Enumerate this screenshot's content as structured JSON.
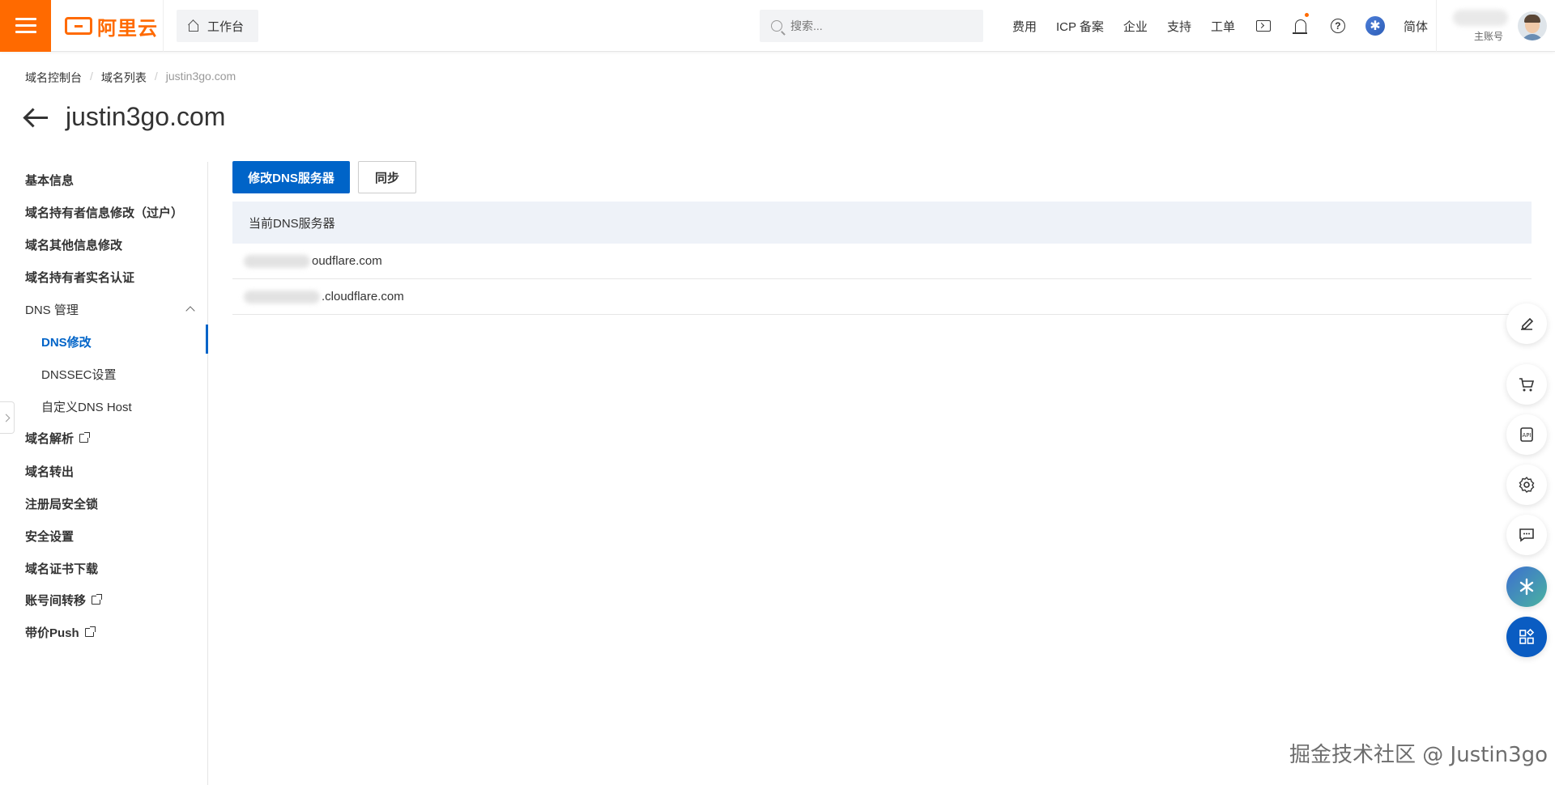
{
  "topbar": {
    "logo_text": "阿里云",
    "workbench_label": "工作台",
    "search_placeholder": "搜索...",
    "nav_items": [
      "费用",
      "ICP 备案",
      "企业",
      "支持",
      "工单"
    ],
    "language": "简体",
    "account_label": "主账号",
    "accent_color": "#ff6a00"
  },
  "breadcrumb": {
    "items": [
      "域名控制台",
      "域名列表",
      "justin3go.com"
    ]
  },
  "page": {
    "title": "justin3go.com"
  },
  "sidebar": {
    "items": [
      {
        "label": "基本信息"
      },
      {
        "label": "域名持有者信息修改（过户）"
      },
      {
        "label": "域名其他信息修改"
      },
      {
        "label": "域名持有者实名认证"
      },
      {
        "label": "DNS 管理"
      },
      {
        "label": "DNS修改"
      },
      {
        "label": "DNSSEC设置"
      },
      {
        "label": "自定义DNS Host"
      },
      {
        "label": "域名解析"
      },
      {
        "label": "域名转出"
      },
      {
        "label": "注册局安全锁"
      },
      {
        "label": "安全设置"
      },
      {
        "label": "域名证书下载"
      },
      {
        "label": "账号间转移"
      },
      {
        "label": "带价Push"
      }
    ]
  },
  "main": {
    "modify_dns_button": "修改DNS服务器",
    "sync_button": "同步",
    "table_header": "当前DNS服务器",
    "dns_servers": [
      "oudflare.com",
      ".cloudflare.com"
    ],
    "primary_color": "#0064c8"
  },
  "floating_tools": [
    "edit-icon",
    "cart-icon",
    "api-icon",
    "settings-icon",
    "feedback-icon",
    "ai-assistant-icon",
    "apps-icon"
  ],
  "watermark": "掘金技术社区 @ Justin3go"
}
